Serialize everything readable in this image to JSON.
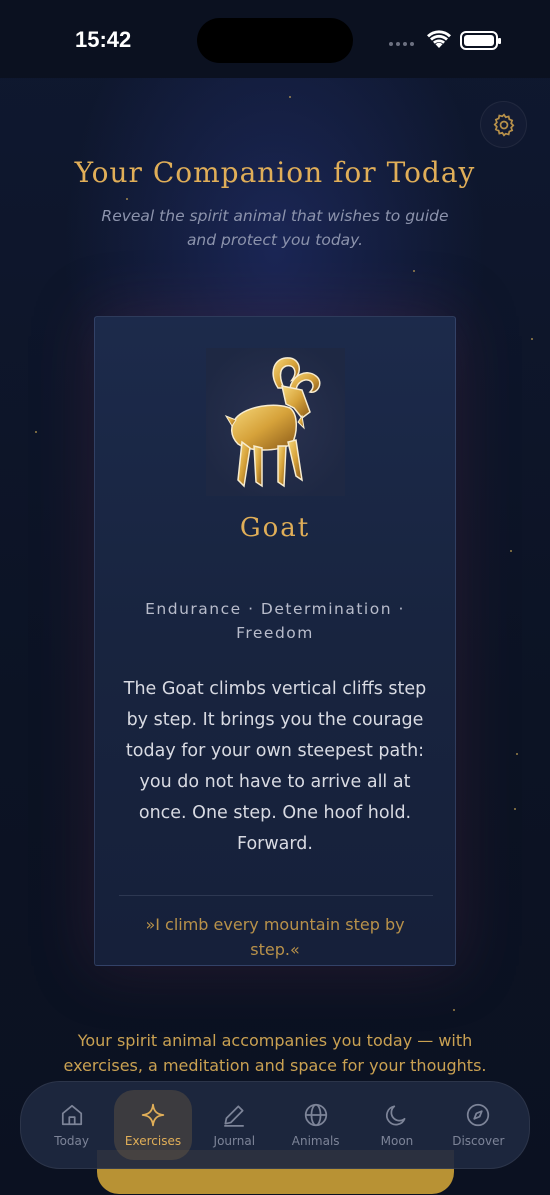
{
  "status_bar": {
    "time": "15:42"
  },
  "header": {
    "title": "Your Companion for Today",
    "subtitle": "Reveal the spirit animal that wishes to guide and protect you today."
  },
  "card": {
    "animal_name": "Goat",
    "traits": "Endurance · Determination · Freedom",
    "description": "The Goat climbs vertical cliffs step by step. It brings you the courage today for your own steepest path: you do not have to arrive all at once. One step. One hoof hold. Forward.",
    "quote": "»I climb every mountain step by step.«",
    "image_icon": "golden-goat-figure"
  },
  "footer_text": "Your spirit animal accompanies you today — with exercises, a meditation and space for your thoughts.",
  "tabs": [
    {
      "label": "Today",
      "icon": "home-icon",
      "active": false
    },
    {
      "label": "Exercises",
      "icon": "sparkle-icon",
      "active": true
    },
    {
      "label": "Journal",
      "icon": "pen-icon",
      "active": false
    },
    {
      "label": "Animals",
      "icon": "globe-icon",
      "active": false
    },
    {
      "label": "Moon",
      "icon": "moon-icon",
      "active": false
    },
    {
      "label": "Discover",
      "icon": "compass-icon",
      "active": false
    }
  ],
  "colors": {
    "accent_gold": "#e0ae58",
    "background": "#0d1426",
    "card": "#1c2a4b"
  }
}
